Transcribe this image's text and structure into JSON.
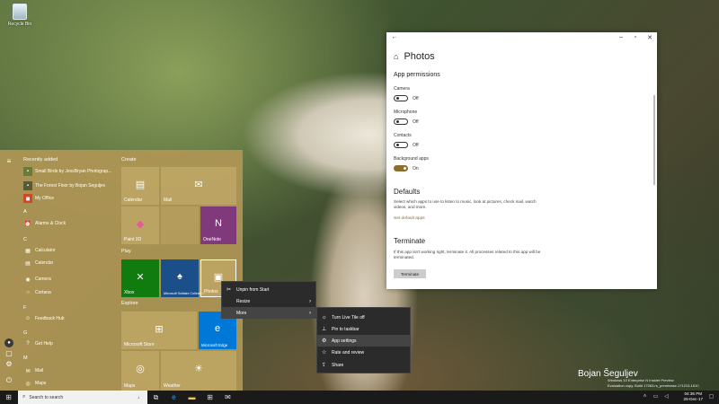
{
  "desktop": {
    "recycle_bin": "Recycle Bin"
  },
  "watermark": {
    "name": "Bojan Šeguljev",
    "line1": "Windows 10 Enterprise N Insider Preview",
    "line2": "Evaluation copy. Build 17063.rs_prerelease.171213-1610"
  },
  "start": {
    "rail_icons": [
      "hamburger-menu-icon",
      "user-avatar",
      "documents-icon",
      "settings-icon",
      "power-icon"
    ],
    "recently_added_title": "Recently added",
    "recent": [
      {
        "label": "Small Birds by JessBryan Photograp...",
        "icon": "photo-thumb-icon"
      },
      {
        "label": "The Forest Floor by Bojan Šeguljev",
        "icon": "photo-thumb-icon"
      },
      {
        "label": "My Office",
        "icon": "office-icon"
      }
    ],
    "letters": [
      "A",
      "C",
      "F",
      "G",
      "M"
    ],
    "apps": [
      {
        "label": "Alarms & Clock",
        "icon": "alarm-icon"
      },
      {
        "label": "Calculator",
        "icon": "calculator-icon"
      },
      {
        "label": "Calendar",
        "icon": "calendar-icon"
      },
      {
        "label": "Camera",
        "icon": "camera-icon"
      },
      {
        "label": "Cortana",
        "icon": "cortana-icon"
      },
      {
        "label": "Feedback Hub",
        "icon": "feedback-icon"
      },
      {
        "label": "Get Help",
        "icon": "help-icon"
      },
      {
        "label": "Mail",
        "icon": "mail-icon"
      },
      {
        "label": "Maps",
        "icon": "maps-icon"
      }
    ],
    "groups": [
      "Create",
      "Play",
      "Explore"
    ],
    "tiles": {
      "calendar": "Calendar",
      "mail": "Mail",
      "paint3d": "Paint 3D",
      "onenote": "OneNote",
      "xbox": "Xbox",
      "solitaire": "Microsoft Solitaire Collection",
      "photos": "Photos",
      "store": "Microsoft Store",
      "edge": "Microsoft Edge",
      "maps": "Maps",
      "weather": "Weather"
    }
  },
  "context_menu": {
    "items": [
      "Unpin from Start",
      "Resize",
      "More"
    ]
  },
  "submenu": {
    "items": [
      "Turn Live Tile off",
      "Pin to taskbar",
      "App settings",
      "Rate and review",
      "Share"
    ]
  },
  "settings": {
    "title": "Photos",
    "permissions_title": "App permissions",
    "perms": [
      {
        "label": "Camera",
        "state": "Off"
      },
      {
        "label": "Microphone",
        "state": "Off"
      },
      {
        "label": "Contacts",
        "state": "Off"
      },
      {
        "label": "Background apps",
        "state": "On"
      }
    ],
    "defaults_title": "Defaults",
    "defaults_text": "Select which apps to use to listen to music, look at pictures, check mail, watch videos, and more.",
    "defaults_link": "Set default apps",
    "terminate_title": "Terminate",
    "terminate_text": "If this app isn't working right, terminate it. All processes related to this app will be terminated.",
    "terminate_button": "Terminate"
  },
  "taskbar": {
    "search_placeholder": "Search to search",
    "time": "04:36 PM",
    "date": "25-Dec-17",
    "colors": {
      "accent": "#8c6d2c"
    }
  }
}
